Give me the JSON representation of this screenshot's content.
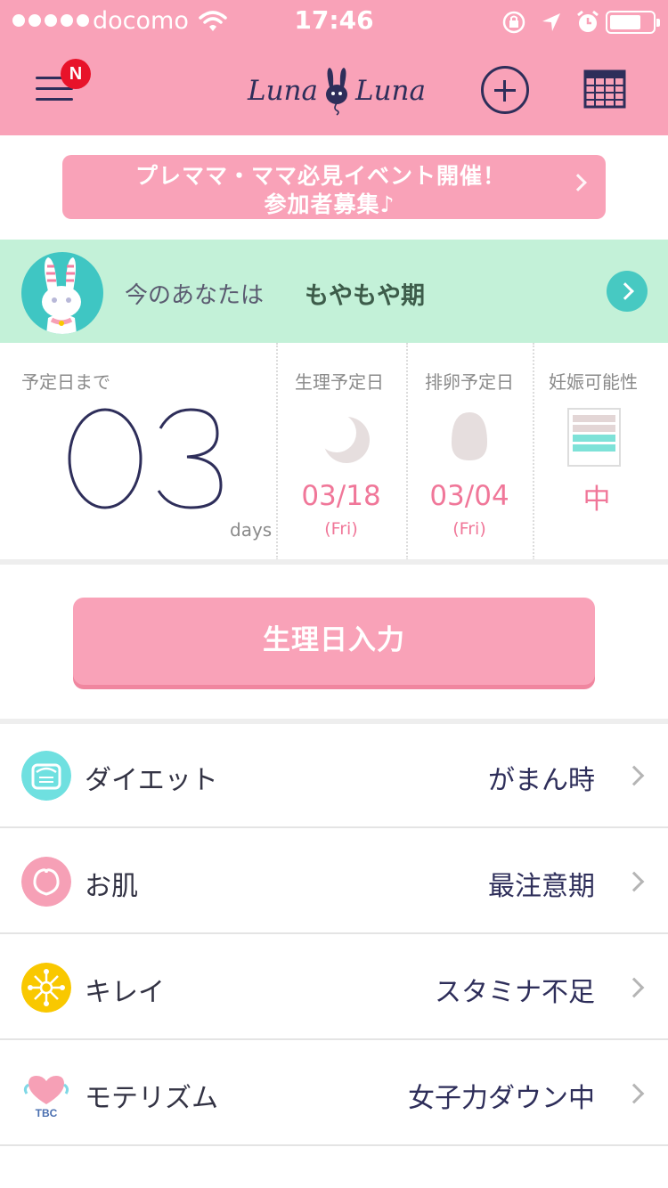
{
  "statusbar": {
    "carrier": "docomo",
    "time": "17:46"
  },
  "header": {
    "badge": "N",
    "logo_left": "Luna",
    "logo_right": "Luna"
  },
  "banner": {
    "line1": "プレママ・ママ必見イベント開催！",
    "line2": "参加者募集♪"
  },
  "status": {
    "label": "今のあなたは",
    "value": "もやもや期"
  },
  "stats": {
    "countdown_label": "予定日まで",
    "countdown_value": "03",
    "countdown_unit": "days",
    "period": {
      "label": "生理予定日",
      "date": "03/18",
      "day": "(Fri)"
    },
    "ovulation": {
      "label": "排卵予定日",
      "date": "03/04",
      "day": "(Fri)"
    },
    "chance": {
      "label": "妊娠可能性",
      "value": "中",
      "level": 0.4
    }
  },
  "main_button": {
    "label": "生理日入力"
  },
  "list": [
    {
      "name": "ダイエット",
      "value": "がまん時",
      "icon": "scale-icon",
      "color": "#6fe0e0"
    },
    {
      "name": "お肌",
      "value": "最注意期",
      "icon": "peach-icon",
      "color": "#f6a0b6"
    },
    {
      "name": "キレイ",
      "value": "スタミナ不足",
      "icon": "sparkle-icon",
      "color": "#f9c800"
    },
    {
      "name": "モテリズム",
      "value": "女子力ダウン中",
      "icon": "tbc-heart-icon",
      "color": "#f6a0b6",
      "icon_text": "TBC"
    }
  ],
  "colors": {
    "header": "#f9a2b8",
    "navy": "#2e2e5a",
    "mint": "#c3f1d8",
    "pink_text": "#f07799"
  }
}
